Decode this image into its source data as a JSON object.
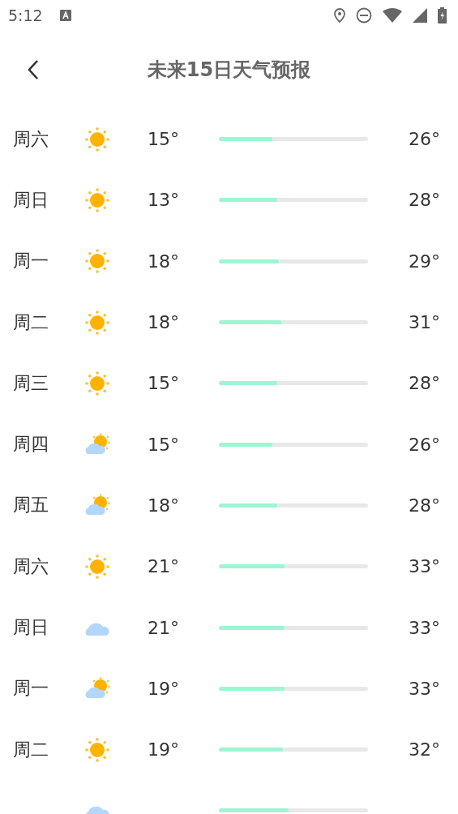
{
  "status_bar": {
    "time": "5:12"
  },
  "header": {
    "title": "未来15日天气预报"
  },
  "days": [
    {
      "day": "周六",
      "kind": "sunny",
      "low": "15°",
      "high": "26°",
      "level": 0.36
    },
    {
      "day": "周日",
      "kind": "sunny",
      "low": "13°",
      "high": "28°",
      "level": 0.39
    },
    {
      "day": "周一",
      "kind": "sunny",
      "low": "18°",
      "high": "29°",
      "level": 0.4
    },
    {
      "day": "周二",
      "kind": "sunny",
      "low": "18°",
      "high": "31°",
      "level": 0.42
    },
    {
      "day": "周三",
      "kind": "sunny",
      "low": "15°",
      "high": "28°",
      "level": 0.39
    },
    {
      "day": "周四",
      "kind": "partly",
      "low": "15°",
      "high": "26°",
      "level": 0.36
    },
    {
      "day": "周五",
      "kind": "partly",
      "low": "18°",
      "high": "28°",
      "level": 0.39
    },
    {
      "day": "周六",
      "kind": "sunny",
      "low": "21°",
      "high": "33°",
      "level": 0.44
    },
    {
      "day": "周日",
      "kind": "cloudy",
      "low": "21°",
      "high": "33°",
      "level": 0.44
    },
    {
      "day": "周一",
      "kind": "partly",
      "low": "19°",
      "high": "33°",
      "level": 0.44
    },
    {
      "day": "周二",
      "kind": "sunny",
      "low": "19°",
      "high": "32°",
      "level": 0.43
    },
    {
      "kind": "cloudy",
      "level": 0.47
    }
  ]
}
